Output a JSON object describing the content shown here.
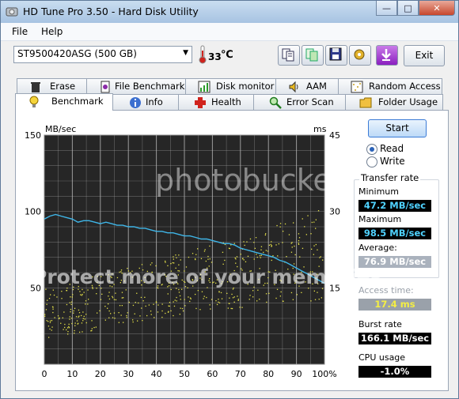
{
  "window": {
    "title": "HD Tune Pro 3.50 - Hard Disk Utility",
    "controls": {
      "minimize": "—",
      "maximize": "□",
      "close": "✕"
    }
  },
  "menu": {
    "file": "File",
    "help": "Help"
  },
  "toolbar": {
    "drive": "ST9500420ASG (500 GB)",
    "temperature": "33",
    "exit_label": "Exit",
    "buttons": [
      "copy-info-icon",
      "copy-screenshot-icon",
      "save-icon",
      "options-icon",
      "download-icon"
    ]
  },
  "tabs": {
    "row1": [
      {
        "label": "Erase",
        "icon": "trash-icon"
      },
      {
        "label": "File Benchmark",
        "icon": "file-benchmark-icon"
      },
      {
        "label": "Disk monitor",
        "icon": "disk-monitor-icon"
      },
      {
        "label": "AAM",
        "icon": "speaker-icon"
      },
      {
        "label": "Random Access",
        "icon": "random-access-icon"
      }
    ],
    "row2": [
      {
        "label": "Benchmark",
        "icon": "lightbulb-icon"
      },
      {
        "label": "Info",
        "icon": "info-icon"
      },
      {
        "label": "Health",
        "icon": "health-cross-icon"
      },
      {
        "label": "Error Scan",
        "icon": "magnifier-icon"
      },
      {
        "label": "Folder Usage",
        "icon": "folder-icon"
      }
    ]
  },
  "controls": {
    "start_label": "Start",
    "read_label": "Read",
    "write_label": "Write",
    "selected_mode": "Read"
  },
  "transfer_rate": {
    "title": "Transfer rate",
    "minimum_label": "Minimum",
    "minimum_value": "47.2 MB/sec",
    "maximum_label": "Maximum",
    "maximum_value": "98.5 MB/sec",
    "average_label": "Average:",
    "average_value": "76.9 MB/sec"
  },
  "stats": {
    "access_time_label": "Access time:",
    "access_time_value": "17.4 ms",
    "burst_rate_label": "Burst rate",
    "burst_rate_value": "166.1 MB/sec",
    "cpu_usage_label": "CPU usage",
    "cpu_usage_value": "-1.0%"
  },
  "watermark": {
    "line1": "photobucket",
    "line2": "Protect more of your memories"
  },
  "colors": {
    "plot_bg": "#262626",
    "grid": "#b8b8b8",
    "transfer_line": "#3fb6e8",
    "access_dots": "#e8e44a"
  },
  "chart_data": {
    "type": "line",
    "ylabel_left": "MB/sec",
    "ylabel_right": "ms",
    "x_ticks": [
      "0",
      "10",
      "20",
      "30",
      "40",
      "50",
      "60",
      "70",
      "80",
      "90",
      "100%"
    ],
    "y_left_ticks": [
      "150",
      "100",
      "50"
    ],
    "y_right_ticks": [
      "45",
      "30",
      "15"
    ],
    "xlim": [
      0,
      100
    ],
    "ylim_left": [
      0,
      150
    ],
    "ylim_right": [
      0,
      45
    ],
    "grid": true,
    "series": [
      {
        "kind": "transfer",
        "x": [
          0,
          2,
          4,
          6,
          8,
          10,
          12,
          14,
          16,
          18,
          20,
          22,
          24,
          26,
          28,
          30,
          32,
          34,
          36,
          38,
          40,
          42,
          44,
          46,
          48,
          50,
          52,
          54,
          56,
          58,
          60,
          62,
          64,
          66,
          68,
          70,
          72,
          74,
          76,
          78,
          80,
          82,
          84,
          86,
          88,
          90,
          92,
          94,
          96,
          98,
          100
        ],
        "values": [
          95,
          97,
          98,
          97,
          96,
          95,
          93,
          94,
          94,
          93,
          92,
          93,
          92,
          91,
          91,
          90,
          90,
          89,
          89,
          88,
          87,
          87,
          86,
          86,
          85,
          84,
          84,
          83,
          82,
          82,
          81,
          80,
          79,
          79,
          78,
          76,
          75,
          74,
          73,
          72,
          71,
          70,
          68,
          67,
          65,
          63,
          61,
          59,
          57,
          55,
          53
        ]
      },
      {
        "kind": "access_time",
        "axis": "right",
        "band_x": [
          0,
          10,
          20,
          30,
          40,
          50,
          60,
          70,
          80,
          90,
          100
        ],
        "band_low_ms": [
          5,
          6,
          7,
          8,
          9,
          10,
          11,
          11,
          12,
          12,
          13
        ],
        "band_high_ms": [
          15,
          16,
          18,
          19,
          21,
          22,
          24,
          25,
          27,
          29,
          31
        ]
      }
    ]
  }
}
